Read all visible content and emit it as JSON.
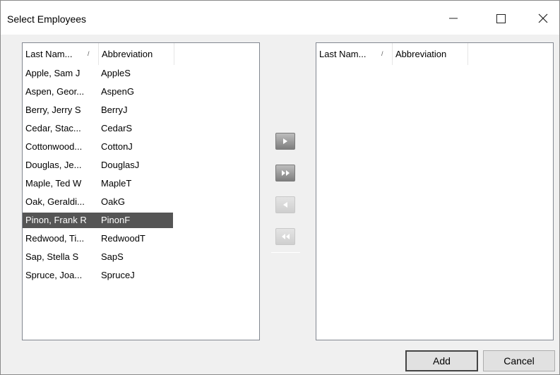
{
  "window": {
    "title": "Select Employees"
  },
  "left_list": {
    "columns": [
      "Last Nam...",
      "Abbreviation"
    ],
    "sort_glyph": "/",
    "rows": [
      {
        "name": "Apple, Sam J",
        "abbr": "AppleS",
        "selected": false
      },
      {
        "name": "Aspen, Geor...",
        "abbr": "AspenG",
        "selected": false
      },
      {
        "name": "Berry, Jerry S",
        "abbr": "BerryJ",
        "selected": false
      },
      {
        "name": "Cedar, Stac...",
        "abbr": "CedarS",
        "selected": false
      },
      {
        "name": "Cottonwood...",
        "abbr": "CottonJ",
        "selected": false
      },
      {
        "name": "Douglas, Je...",
        "abbr": "DouglasJ",
        "selected": false
      },
      {
        "name": "Maple, Ted W",
        "abbr": "MapleT",
        "selected": false
      },
      {
        "name": "Oak, Geraldi...",
        "abbr": "OakG",
        "selected": false
      },
      {
        "name": "Pinon, Frank R",
        "abbr": "PinonF",
        "selected": true
      },
      {
        "name": "Redwood, Ti...",
        "abbr": "RedwoodT",
        "selected": false
      },
      {
        "name": "Sap, Stella S",
        "abbr": "SapS",
        "selected": false
      },
      {
        "name": "Spruce, Joa...",
        "abbr": "SpruceJ",
        "selected": false
      }
    ]
  },
  "right_list": {
    "columns": [
      "Last Nam...",
      "Abbreviation"
    ],
    "sort_glyph": "/",
    "rows": []
  },
  "move_buttons": [
    {
      "icon": "move-right-icon",
      "enabled": true
    },
    {
      "icon": "move-all-right-icon",
      "enabled": true
    },
    {
      "icon": "move-left-icon",
      "enabled": false
    },
    {
      "icon": "move-all-left-icon",
      "enabled": false
    }
  ],
  "footer": {
    "add_label": "Add",
    "cancel_label": "Cancel"
  }
}
